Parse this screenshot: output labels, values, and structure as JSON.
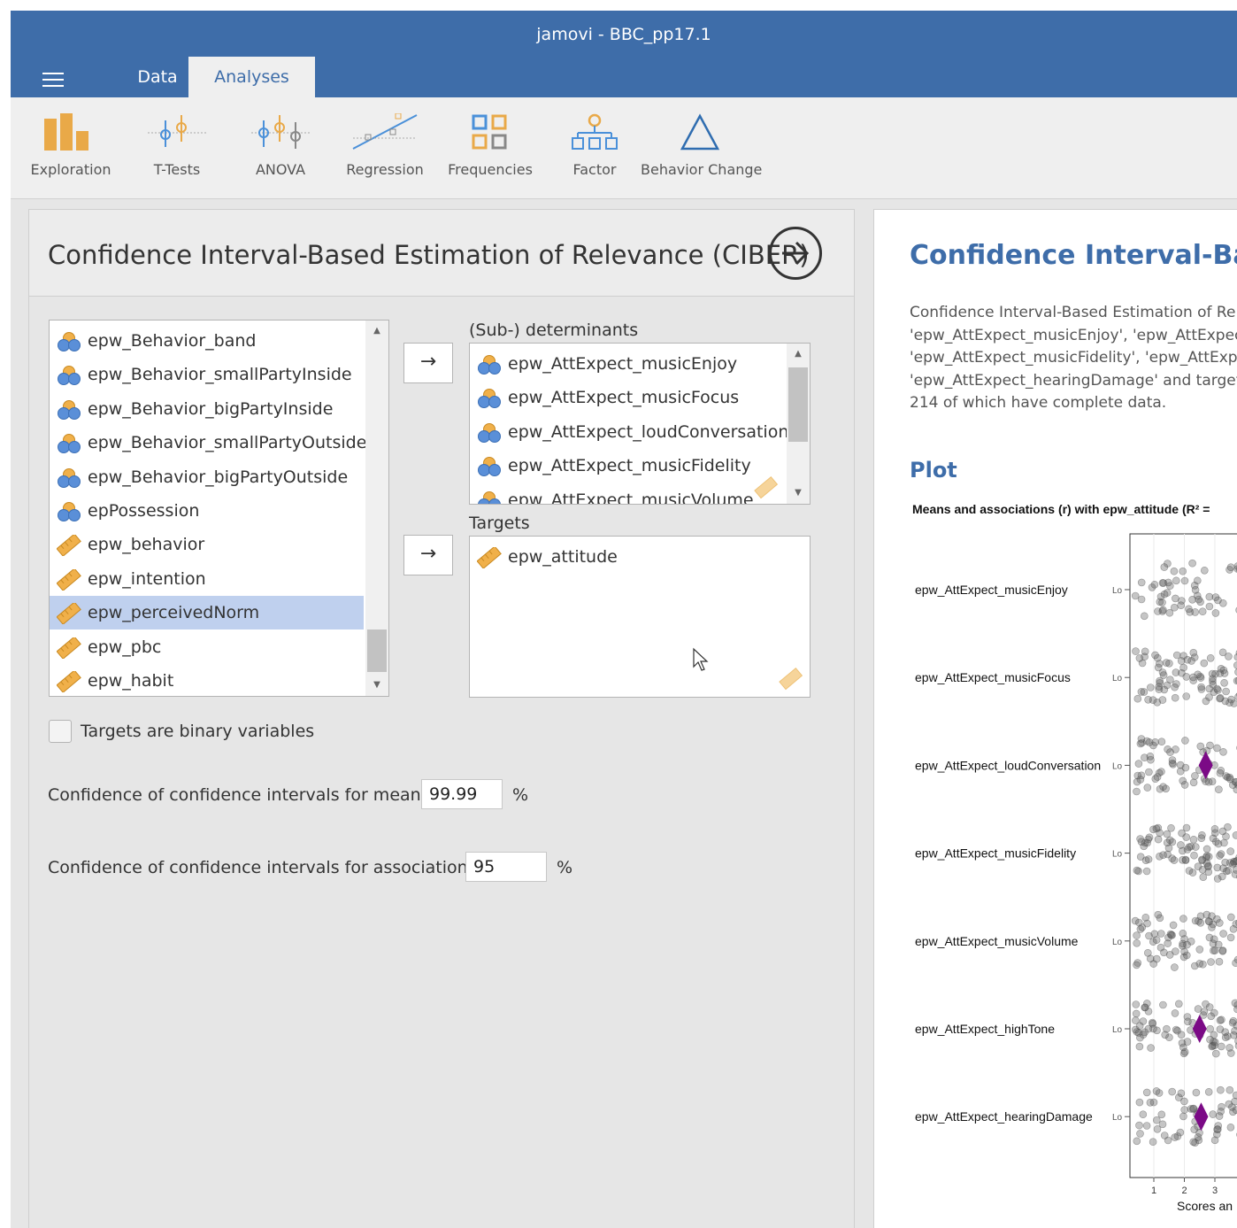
{
  "window": {
    "title": "jamovi - BBC_pp17.1"
  },
  "tabs": [
    {
      "label": "Data"
    },
    {
      "label": "Analyses"
    }
  ],
  "ribbon": [
    {
      "label": "Exploration",
      "icon": "exploration-icon"
    },
    {
      "label": "T-Tests",
      "icon": "t-tests-icon"
    },
    {
      "label": "ANOVA",
      "icon": "anova-icon"
    },
    {
      "label": "Regression",
      "icon": "regression-icon"
    },
    {
      "label": "Frequencies",
      "icon": "frequencies-icon"
    },
    {
      "label": "Factor",
      "icon": "factor-icon"
    },
    {
      "label": "Behavior Change",
      "icon": "behavior-change-icon"
    }
  ],
  "options_panel": {
    "title": "Confidence Interval-Based Estimation of Relevance (CIBER)",
    "variables": [
      {
        "name": "epw_Behavior_band",
        "type": "nominal"
      },
      {
        "name": "epw_Behavior_smallPartyInside",
        "type": "nominal"
      },
      {
        "name": "epw_Behavior_bigPartyInside",
        "type": "nominal"
      },
      {
        "name": "epw_Behavior_smallPartyOutside",
        "type": "nominal"
      },
      {
        "name": "epw_Behavior_bigPartyOutside",
        "type": "nominal"
      },
      {
        "name": "epPossession",
        "type": "nominal"
      },
      {
        "name": "epw_behavior",
        "type": "continuous"
      },
      {
        "name": "epw_intention",
        "type": "continuous"
      },
      {
        "name": "epw_perceivedNorm",
        "type": "continuous",
        "selected": true
      },
      {
        "name": "epw_pbc",
        "type": "continuous"
      },
      {
        "name": "epw_habit",
        "type": "continuous"
      }
    ],
    "determinants_label": "(Sub-) determinants",
    "determinants": [
      {
        "name": "epw_AttExpect_musicEnjoy",
        "type": "nominal"
      },
      {
        "name": "epw_AttExpect_musicFocus",
        "type": "nominal"
      },
      {
        "name": "epw_AttExpect_loudConversation",
        "type": "nominal"
      },
      {
        "name": "epw_AttExpect_musicFidelity",
        "type": "nominal"
      },
      {
        "name": "epw_AttExpect_musicVolume",
        "type": "nominal"
      }
    ],
    "targets_label": "Targets",
    "targets": [
      {
        "name": "epw_attitude",
        "type": "continuous"
      }
    ],
    "binary_label": "Targets are binary variables",
    "binary_checked": false,
    "conf_means_label": "Confidence of confidence intervals for means:",
    "conf_means_value": "99.99",
    "conf_assoc_label": "Confidence of confidence intervals for associations:",
    "conf_assoc_value": "95",
    "percent": "%",
    "move_arrow": "→"
  },
  "results": {
    "title": "Confidence Interval-Based",
    "text_lines": [
      "Confidence Interval-Based Estimation of Rel",
      "'epw_AttExpect_musicEnjoy', 'epw_AttExpect",
      "'epw_AttExpect_musicFidelity', 'epw_AttExpe",
      "'epw_AttExpect_hearingDamage' and target",
      "214 of which have complete data."
    ],
    "plot_heading": "Plot",
    "plot_title": "Means and associations (r) with epw_attitude (R² =",
    "rows": [
      {
        "label": "epw_AttExpect_musicEnjoy",
        "mean": null
      },
      {
        "label": "epw_AttExpect_musicFocus",
        "mean": null
      },
      {
        "label": "epw_AttExpect_loudConversation",
        "mean": 2.7
      },
      {
        "label": "epw_AttExpect_musicFidelity",
        "mean": null
      },
      {
        "label": "epw_AttExpect_musicVolume",
        "mean": null
      },
      {
        "label": "epw_AttExpect_highTone",
        "mean": 2.5
      },
      {
        "label": "epw_AttExpect_hearingDamage",
        "mean": 2.55
      }
    ],
    "row_tick": "Lo",
    "x_ticks": [
      "1",
      "2",
      "3"
    ],
    "x_label": "Scores an",
    "colors": {
      "accent": "#3e6da9",
      "mean_marker": "#7b0a86",
      "assoc_marker": "#1a1aff"
    }
  }
}
